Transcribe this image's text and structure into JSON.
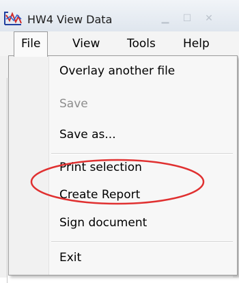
{
  "window": {
    "title": "HW4 View Data"
  },
  "menubar": {
    "items": [
      "File",
      "View",
      "Tools",
      "Help"
    ],
    "active": "File"
  },
  "file_menu": {
    "items": [
      {
        "label": "Overlay another file",
        "enabled": true
      },
      {
        "label": "Save",
        "enabled": false
      },
      {
        "label": "Save as...",
        "enabled": true
      },
      {
        "label": "Print selection",
        "enabled": true
      },
      {
        "label": "Create Report",
        "enabled": true
      },
      {
        "label": "Sign document",
        "enabled": true
      },
      {
        "label": "Exit",
        "enabled": true
      }
    ]
  },
  "annotation": {
    "color": "#e03030"
  }
}
